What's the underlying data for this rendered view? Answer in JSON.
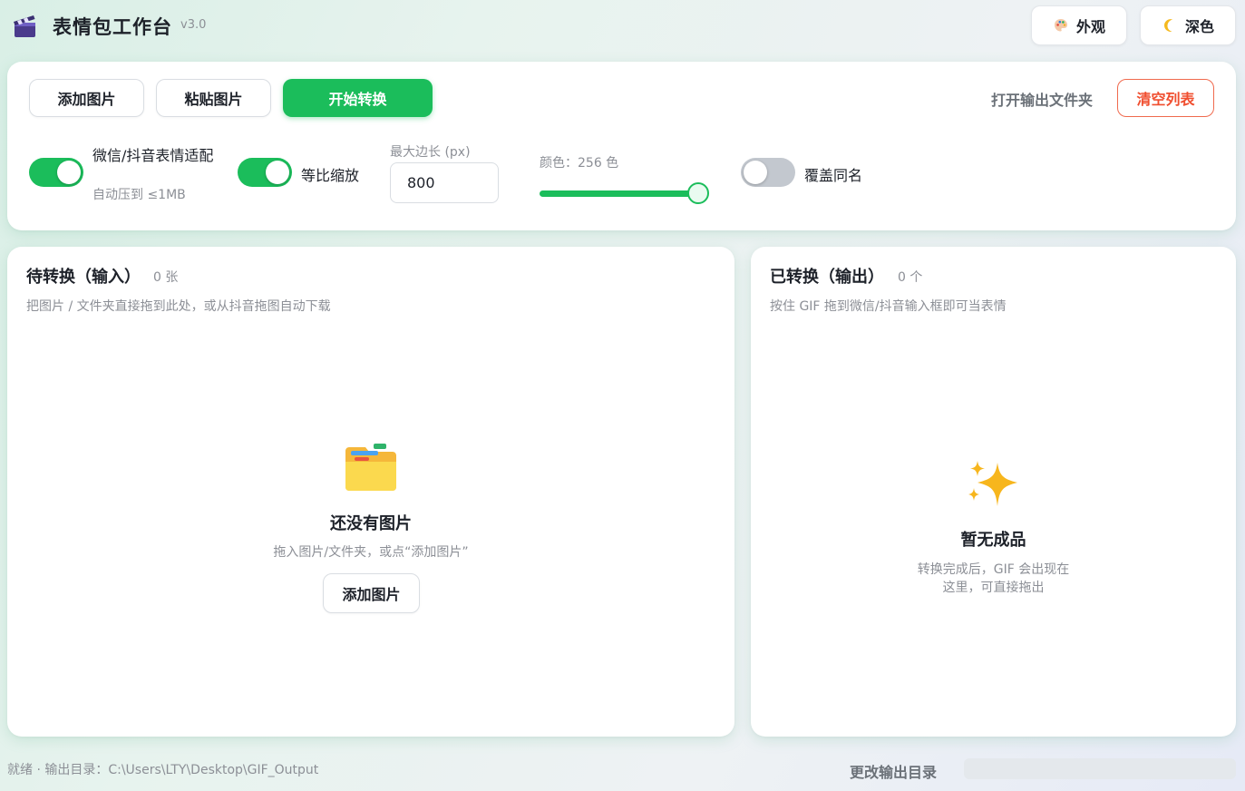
{
  "app": {
    "title": "表情包工作台",
    "version": "v3.0",
    "icons": {
      "logo": "clapperboard-icon"
    }
  },
  "header": {
    "appearance_label": "外观",
    "appearance_icon": "palette-icon",
    "theme_label": "深色",
    "theme_icon": "moon-icon"
  },
  "toolbar": {
    "add_label": "添加图片",
    "paste_label": "粘贴图片",
    "start_label": "开始转换",
    "open_output_label": "打开输出文件夹",
    "clear_label": "清空列表"
  },
  "options": {
    "wechat_label": "微信/抖音表情适配",
    "wechat_sub": "自动压到 ≤1MB",
    "wechat_on": true,
    "ratio_label": "等比缩放",
    "ratio_on": true,
    "max_edge_label": "最大边长 (px)",
    "max_edge_value": "800",
    "color_label": "颜色：256 色",
    "color_fraction": 1.0,
    "overwrite_label": "覆盖同名",
    "overwrite_on": false
  },
  "input_panel": {
    "title": "待转换（输入）",
    "count": "0 张",
    "desc": "把图片 / 文件夹直接拖到此处，或从抖音拖图自动下载",
    "empty_title": "还没有图片",
    "empty_desc": "拖入图片/文件夹，或点“添加图片”",
    "empty_button": "添加图片",
    "empty_icon": "folder-icon"
  },
  "output_panel": {
    "title": "已转换（输出）",
    "count": "0 个",
    "desc": "按住 GIF 拖到微信/抖音输入框即可当表情",
    "empty_title": "暂无成品",
    "empty_desc": "转换完成后，GIF 会出现在这里，可直接拖出",
    "empty_icon": "sparkles-icon"
  },
  "statusbar": {
    "status": "就绪 · 输出目录：C:\\Users\\LTY\\Desktop\\GIF_Output",
    "change_output_label": "更改输出目录",
    "progress": 0
  },
  "colors": {
    "accent": "#1bbd5b",
    "danger": "#f04e2f",
    "muted_text": "#8c8f96"
  }
}
